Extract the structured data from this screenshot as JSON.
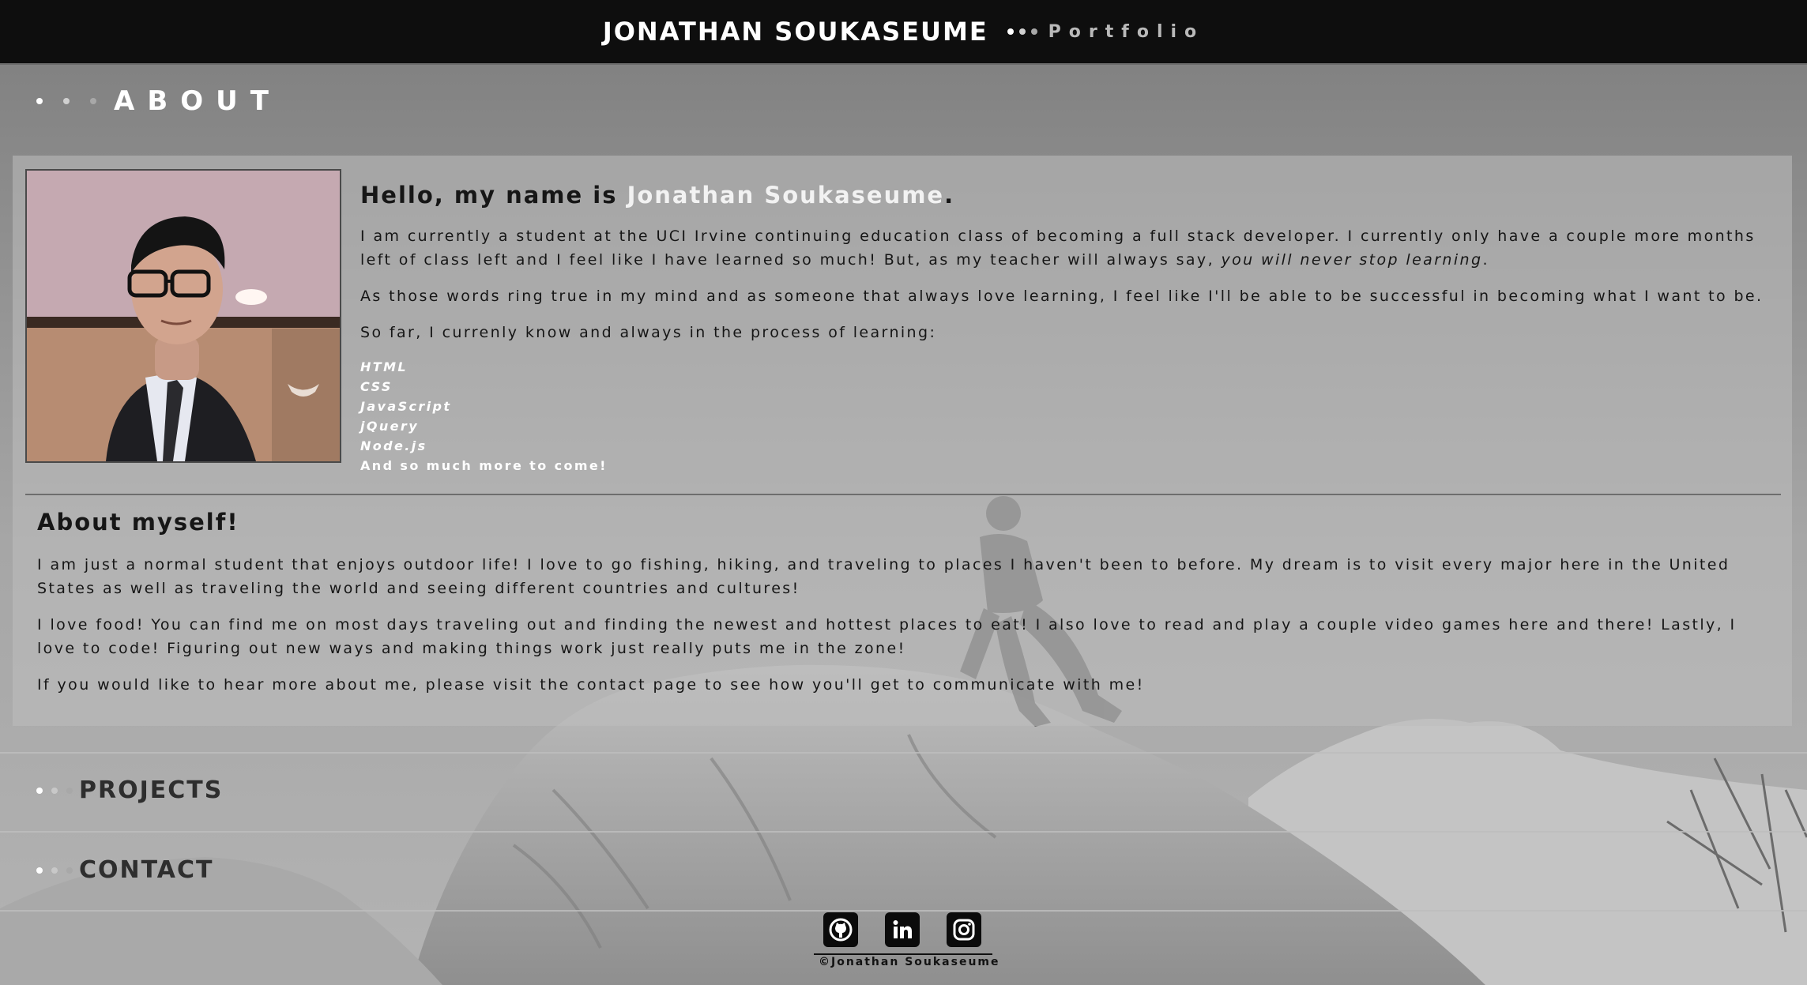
{
  "header": {
    "name": "JONATHAN SOUKASEUME",
    "subtitle": "Portfolio"
  },
  "about": {
    "title": "ABOUT",
    "greeting_prefix": "Hello, my name is ",
    "greeting_name": "Jonathan Soukaseume",
    "greeting_suffix": ".",
    "para1_main": "I am currently a student at the UCI Irvine continuing education class of becoming a full stack developer. I currently only have a couple more months left of class left and I feel like I have learned so much! But, as my teacher will always say, ",
    "para1_emph": "you will never stop learning",
    "para1_end": ".",
    "para2": "As those words ring true in my mind and as someone that always love learning, I feel like I'll be able to be successful in becoming what I want to be.",
    "para3": "So far, I currenly know and always in the process of learning:",
    "skills": [
      "HTML",
      "CSS",
      "JavaScript",
      "jQuery",
      "Node.js"
    ],
    "skills_more": "And so much more to come!",
    "myself_title": "About myself!",
    "myself_p1": "I am just a normal student that enjoys outdoor life! I love to go fishing, hiking, and traveling to places I haven't been to before. My dream is to visit every major here in the United States as well as traveling the world and seeing different countries and cultures!",
    "myself_p2": "I love food! You can find me on most days traveling out and finding the newest and hottest places to eat! I also love to read and play a couple video games here and there! Lastly, I love to code! Figuring out new ways and making things work just really puts me in the zone!",
    "myself_p3": "If you would like to hear more about me, please visit the contact page to see how you'll get to communicate with me!"
  },
  "sections": {
    "projects": "PROJECTS",
    "contact": "CONTACT"
  },
  "footer": {
    "icons": [
      "github-icon",
      "linkedin-icon",
      "instagram-icon"
    ],
    "copyright": "©Jonathan Soukaseume"
  },
  "colors": {
    "header_bg": "#0e0e0e",
    "name_highlight": "#f2f2f2",
    "dot_light": "#ffffff",
    "dot_mid": "#d0d0d0",
    "dot_dim": "#a8a8a8"
  }
}
